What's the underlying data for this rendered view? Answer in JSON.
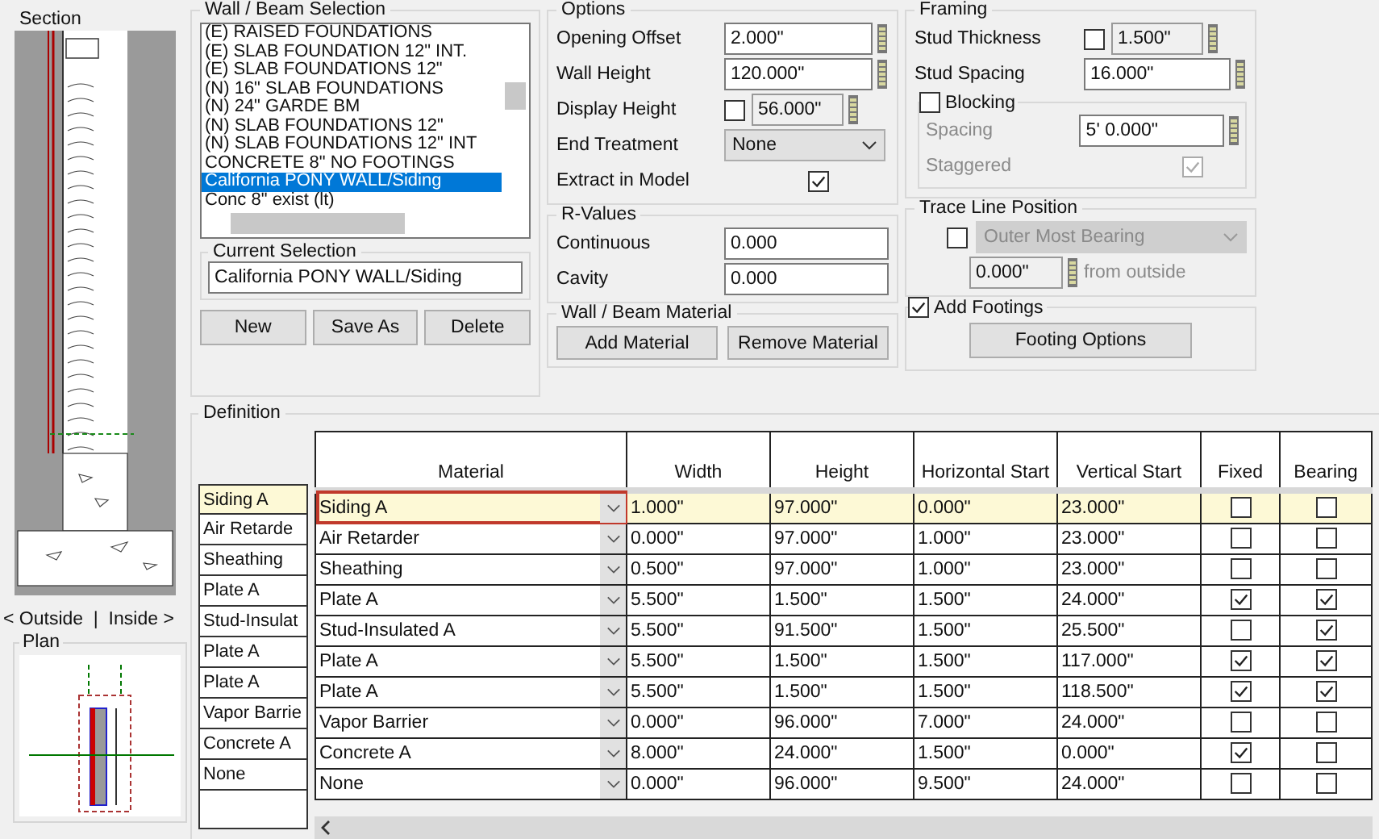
{
  "section": {
    "title": "Section",
    "side_labels": "< Outside  |  Inside >",
    "plan_title": "Plan"
  },
  "wall_beam_selection": {
    "title": "Wall / Beam Selection",
    "items": [
      {
        "label": "(E) RAISED FOUNDATIONS",
        "selected": false
      },
      {
        "label": "(E) SLAB FOUNDATION 12\" INT.",
        "selected": false
      },
      {
        "label": "(E) SLAB FOUNDATIONS 12\"",
        "selected": false
      },
      {
        "label": "(N) 16\" SLAB FOUNDATIONS",
        "selected": false
      },
      {
        "label": "(N) 24\" GARDE BM",
        "selected": false
      },
      {
        "label": "(N) SLAB FOUNDATIONS 12\"",
        "selected": false
      },
      {
        "label": "(N) SLAB FOUNDATIONS 12\" INT",
        "selected": false
      },
      {
        "label": "CONCRETE 8\" NO FOOTINGS",
        "selected": false
      },
      {
        "label": "California PONY WALL/Siding",
        "selected": true
      },
      {
        "label": "Conc 8\" exist (lt)",
        "selected": false
      }
    ],
    "current_selection": {
      "title": "Current Selection",
      "value": "California PONY WALL/Siding"
    },
    "buttons": [
      "New",
      "Save As",
      "Delete"
    ]
  },
  "options": {
    "title": "Options",
    "fields": [
      {
        "kind": "spin",
        "label": "Opening Offset",
        "value": "2.000\""
      },
      {
        "kind": "spin",
        "label": "Wall Height",
        "value": "120.000\""
      },
      {
        "kind": "checkspin",
        "label": "Display Height",
        "checked": false,
        "value": "56.000\""
      },
      {
        "kind": "select",
        "label": "End Treatment",
        "value": "None"
      },
      {
        "kind": "check",
        "label": "Extract in Model",
        "checked": true
      }
    ]
  },
  "r_values": {
    "title": "R-Values",
    "fields": [
      {
        "label": "Continuous",
        "value": "0.000"
      },
      {
        "label": "Cavity",
        "value": "0.000"
      }
    ]
  },
  "material": {
    "title": "Wall / Beam Material",
    "buttons": [
      "Add Material",
      "Remove Material"
    ]
  },
  "framing": {
    "title": "Framing",
    "stud_thickness": {
      "label": "Stud Thickness",
      "checked": false,
      "value": "1.500\""
    },
    "stud_spacing": {
      "label": "Stud Spacing",
      "value": "16.000\""
    },
    "blocking": {
      "label": "Blocking",
      "checked": false,
      "spacing_label": "Spacing",
      "spacing": "5' 0.000\"",
      "staggered_label": "Staggered",
      "staggered": true
    }
  },
  "trace_line": {
    "title": "Trace Line Position",
    "checked": false,
    "value": "Outer Most Bearing",
    "offset": "0.000\"",
    "suffix": "from outside"
  },
  "footings": {
    "label": "Add Footings",
    "checked": true,
    "button": "Footing Options"
  },
  "definition": {
    "title": "Definition",
    "columns": [
      "Material",
      "Width",
      "Height",
      "Horizontal Start",
      "Vertical Start",
      "Fixed",
      "Bearing"
    ],
    "rows": [
      {
        "name": "Siding A",
        "material": "Siding A",
        "width": "1.000\"",
        "height": "97.000\"",
        "h_start": "0.000\"",
        "v_start": "23.000\"",
        "fixed": false,
        "bearing": false,
        "selected": true
      },
      {
        "name": "Air Retarde",
        "material": "Air Retarder",
        "width": "0.000\"",
        "height": "97.000\"",
        "h_start": "1.000\"",
        "v_start": "23.000\"",
        "fixed": false,
        "bearing": false,
        "selected": false
      },
      {
        "name": "Sheathing",
        "material": "Sheathing",
        "width": "0.500\"",
        "height": "97.000\"",
        "h_start": "1.000\"",
        "v_start": "23.000\"",
        "fixed": false,
        "bearing": false,
        "selected": false
      },
      {
        "name": "Plate A",
        "material": "Plate A",
        "width": "5.500\"",
        "height": "1.500\"",
        "h_start": "1.500\"",
        "v_start": "24.000\"",
        "fixed": true,
        "bearing": true,
        "selected": false
      },
      {
        "name": "Stud-Insulat",
        "material": "Stud-Insulated A",
        "width": "5.500\"",
        "height": "91.500\"",
        "h_start": "1.500\"",
        "v_start": "25.500\"",
        "fixed": false,
        "bearing": true,
        "selected": false
      },
      {
        "name": "Plate A",
        "material": "Plate A",
        "width": "5.500\"",
        "height": "1.500\"",
        "h_start": "1.500\"",
        "v_start": "117.000\"",
        "fixed": true,
        "bearing": true,
        "selected": false
      },
      {
        "name": "Plate A",
        "material": "Plate A",
        "width": "5.500\"",
        "height": "1.500\"",
        "h_start": "1.500\"",
        "v_start": "118.500\"",
        "fixed": true,
        "bearing": true,
        "selected": false
      },
      {
        "name": "Vapor Barrie",
        "material": "Vapor Barrier",
        "width": "0.000\"",
        "height": "96.000\"",
        "h_start": "7.000\"",
        "v_start": "24.000\"",
        "fixed": false,
        "bearing": false,
        "selected": false
      },
      {
        "name": "Concrete A",
        "material": "Concrete A",
        "width": "8.000\"",
        "height": "24.000\"",
        "h_start": "1.500\"",
        "v_start": "0.000\"",
        "fixed": true,
        "bearing": false,
        "selected": false
      },
      {
        "name": "None",
        "material": "None",
        "width": "0.000\"",
        "height": "96.000\"",
        "h_start": "9.500\"",
        "v_start": "24.000\"",
        "fixed": false,
        "bearing": false,
        "selected": false
      }
    ]
  }
}
